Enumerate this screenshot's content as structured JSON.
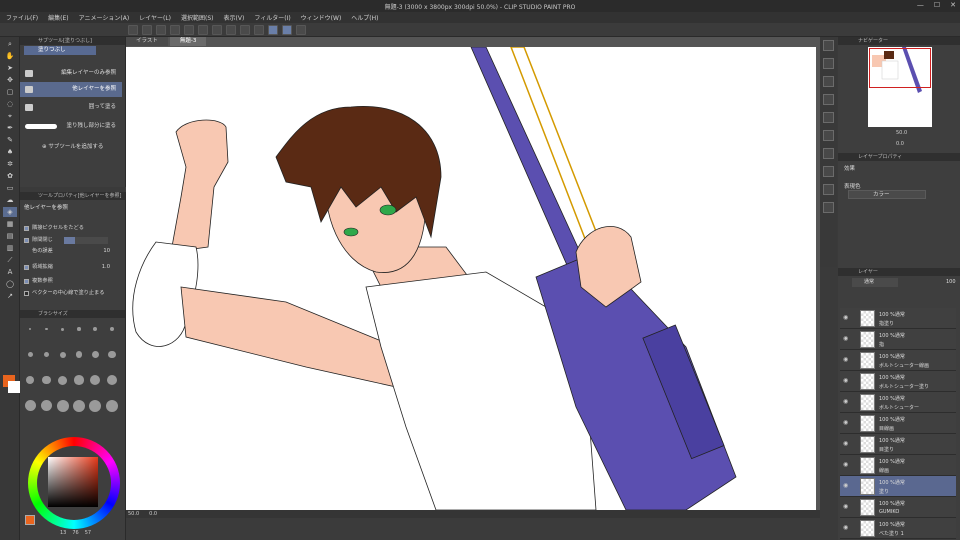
{
  "window": {
    "title": "無題-3 (3000 x 3800px 300dpi 50.0%) - CLIP STUDIO PAINT PRO"
  },
  "menu": [
    "ファイル(F)",
    "編集(E)",
    "アニメーション(A)",
    "レイヤー(L)",
    "選択範囲(S)",
    "表示(V)",
    "フィルター(I)",
    "ウィンドウ(W)",
    "ヘルプ(H)"
  ],
  "tabs": [
    {
      "label": "イラスト",
      "active": false
    },
    {
      "label": "無題-3",
      "active": true
    }
  ],
  "subtool": {
    "header": "サブツール[塗りつぶし]",
    "group_tab": "塗りつぶし",
    "items": [
      {
        "label": "編集レイヤーのみ参照",
        "selected": false
      },
      {
        "label": "他レイヤーを参照",
        "selected": true
      },
      {
        "label": "囲って塗る",
        "selected": false
      },
      {
        "label": "塗り残し部分に塗る",
        "selected": false
      }
    ],
    "add_label": "サブツールを追加する"
  },
  "tool_property": {
    "header": "ツールプロパティ[他レイヤーを参照]",
    "name": "他レイヤーを参照",
    "rows": [
      {
        "label": "隣接ピクセルをたどる",
        "checked": true
      },
      {
        "label": "隙間閉じ",
        "checked": true
      },
      {
        "label": "色の誤差",
        "value": "10"
      },
      {
        "label": "領域拡縮",
        "checked": true,
        "value": "1.0"
      },
      {
        "label": "複数参照",
        "checked": true
      },
      {
        "label": "ベクターの中心線で塗り止まる",
        "checked": false
      }
    ]
  },
  "brush_size": {
    "header": "ブラシサイズ",
    "sizes": [
      "0.7",
      "1",
      "1.5",
      "2",
      "2.5",
      "3",
      "4",
      "5",
      "6",
      "7",
      "8",
      "10",
      "12",
      "15",
      "17",
      "20",
      "25",
      "30",
      "40",
      "50",
      "60",
      "70",
      "80",
      "100"
    ]
  },
  "color": {
    "main": "#e8641e",
    "sub": "#ffffff",
    "readout": [
      "13",
      "76",
      "57"
    ]
  },
  "status": {
    "zoom": "50.0",
    "angle": "0.0"
  },
  "navigator": {
    "header": "ナビゲーター",
    "zoom": "50.0",
    "angle": "0.0"
  },
  "layer_property": {
    "header": "レイヤープロパティ",
    "effect_label": "効果",
    "expression_label": "表現色",
    "expression_value": "カラー"
  },
  "layers_panel": {
    "header": "レイヤー",
    "blend_mode": "通常",
    "opacity": "100"
  },
  "layers": [
    {
      "line1": "100 %通常",
      "line2": "指塗り",
      "selected": false
    },
    {
      "line1": "100 %通常",
      "line2": "指",
      "selected": false
    },
    {
      "line1": "100 %通常",
      "line2": "ボルトシューター線画",
      "selected": false
    },
    {
      "line1": "100 %通常",
      "line2": "ボルトシューター塗り",
      "selected": false
    },
    {
      "line1": "100 %通常",
      "line2": "ボルトシューター",
      "selected": false
    },
    {
      "line1": "100 %通常",
      "line2": "目線画",
      "selected": false
    },
    {
      "line1": "100 %通常",
      "line2": "目塗り",
      "selected": false
    },
    {
      "line1": "100 %通常",
      "line2": "線画",
      "selected": false
    },
    {
      "line1": "100 %通常",
      "line2": "塗り",
      "selected": true
    },
    {
      "line1": "100 %通常",
      "line2": "GUMIKO",
      "selected": false
    },
    {
      "line1": "100 %通常",
      "line2": "べた塗り 1",
      "selected": false
    }
  ]
}
